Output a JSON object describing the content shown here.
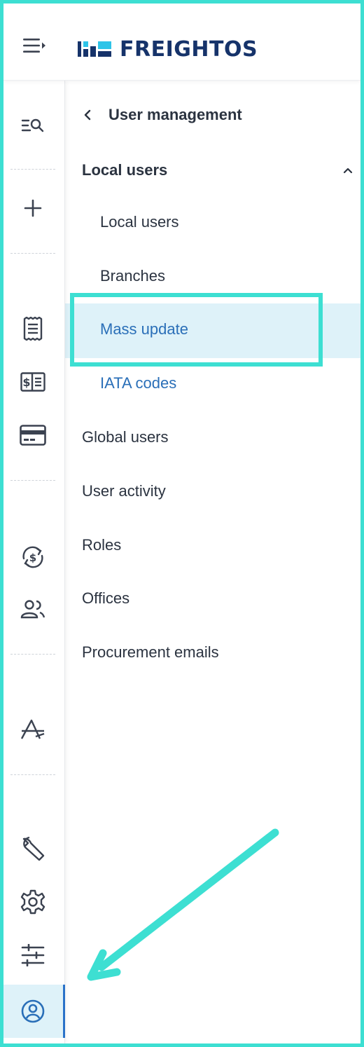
{
  "header": {
    "menu_icon": "menu-toggle-icon",
    "logo_text": "FREIGHTOS",
    "logo_colors": {
      "text": "#16336a",
      "mark_dark": "#16336a",
      "mark_light": "#2ec4e8"
    }
  },
  "rail": {
    "icons": [
      {
        "name": "search-list-icon"
      },
      {
        "name": "add-icon"
      },
      {
        "name": "document-list-icon"
      },
      {
        "name": "invoice-icon"
      },
      {
        "name": "credit-card-icon"
      },
      {
        "name": "currency-exchange-icon"
      },
      {
        "name": "users-icon"
      },
      {
        "name": "analytics-icon"
      },
      {
        "name": "wrench-icon"
      },
      {
        "name": "gear-icon"
      },
      {
        "name": "sliders-icon"
      },
      {
        "name": "account-icon"
      }
    ],
    "active_icon": "account-icon"
  },
  "panel": {
    "back_label": "User management",
    "group": {
      "title": "Local users",
      "expanded": true,
      "items": [
        {
          "label": "Local users",
          "active": false
        },
        {
          "label": "Branches",
          "active": false
        },
        {
          "label": "Mass update",
          "active": true
        },
        {
          "label": "IATA codes",
          "active": false
        }
      ]
    },
    "nav_items": [
      {
        "label": "Global users"
      },
      {
        "label": "User activity"
      },
      {
        "label": "Roles"
      },
      {
        "label": "Offices"
      },
      {
        "label": "Procurement emails"
      }
    ]
  },
  "colors": {
    "accent_frame": "#3ddfd2",
    "active_bg": "#def2f9",
    "link_blue": "#2a6fb8",
    "active_rail_border": "#2a72c9"
  }
}
